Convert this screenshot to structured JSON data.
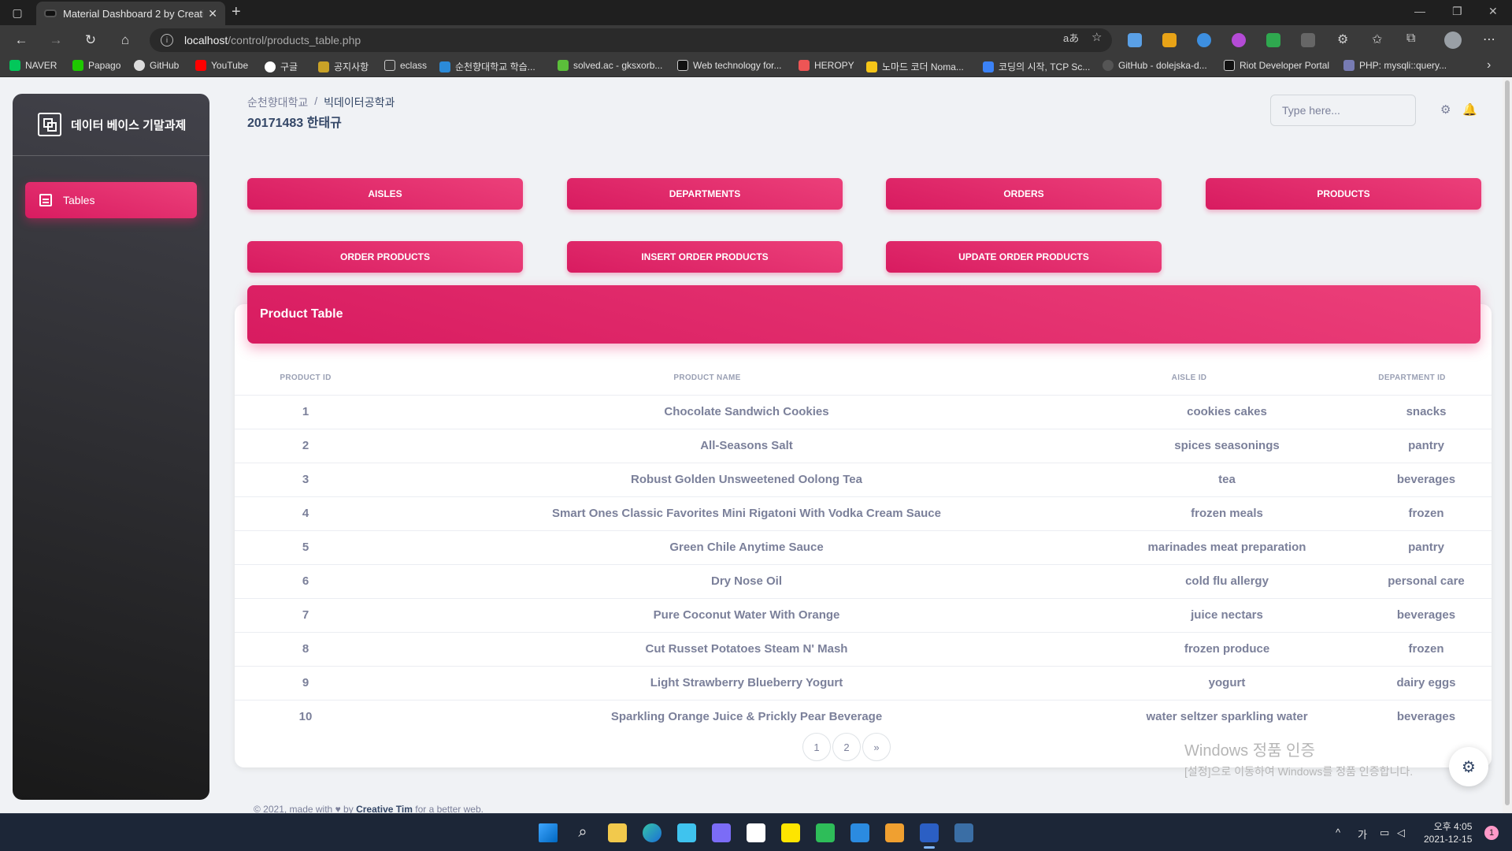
{
  "browser": {
    "tab_title": "Material Dashboard 2 by Creativ...",
    "url_host": "localhost",
    "url_path": "/control/products_table.php",
    "bookmarks": [
      "NAVER",
      "Papago",
      "GitHub",
      "YouTube",
      "구글",
      "공지사항",
      "eclass",
      "순천향대학교 학습...",
      "solved.ac - gksxorb...",
      "Web technology for...",
      "HEROPY",
      "노마드 코더 Noma...",
      "코딩의 시작, TCP Sc...",
      "GitHub - dolejska-d...",
      "Riot Developer Portal",
      "PHP: mysqli::query..."
    ]
  },
  "sidebar": {
    "brand": "데이터 베이스 기말과제",
    "items": [
      {
        "label": "Tables"
      }
    ]
  },
  "header": {
    "breadcrumb_root": "순천향대학교",
    "breadcrumb_sep": "/",
    "breadcrumb_current": "빅데이터공학과",
    "title": "20171483 한태규",
    "search_placeholder": "Type here..."
  },
  "nav_buttons": [
    "AISLES",
    "DEPARTMENTS",
    "ORDERS",
    "PRODUCTS",
    "ORDER PRODUCTS",
    "INSERT ORDER PRODUCTS",
    "UPDATE ORDER PRODUCTS"
  ],
  "table": {
    "title": "Product Table",
    "columns": [
      "PRODUCT ID",
      "PRODUCT NAME",
      "AISLE ID",
      "DEPARTMENT ID"
    ],
    "rows": [
      {
        "id": "1",
        "name": "Chocolate Sandwich Cookies",
        "aisle": "cookies cakes",
        "dept": "snacks"
      },
      {
        "id": "2",
        "name": "All-Seasons Salt",
        "aisle": "spices seasonings",
        "dept": "pantry"
      },
      {
        "id": "3",
        "name": "Robust Golden Unsweetened Oolong Tea",
        "aisle": "tea",
        "dept": "beverages"
      },
      {
        "id": "4",
        "name": "Smart Ones Classic Favorites Mini Rigatoni With Vodka Cream Sauce",
        "aisle": "frozen meals",
        "dept": "frozen"
      },
      {
        "id": "5",
        "name": "Green Chile Anytime Sauce",
        "aisle": "marinades meat preparation",
        "dept": "pantry"
      },
      {
        "id": "6",
        "name": "Dry Nose Oil",
        "aisle": "cold flu allergy",
        "dept": "personal care"
      },
      {
        "id": "7",
        "name": "Pure Coconut Water With Orange",
        "aisle": "juice nectars",
        "dept": "beverages"
      },
      {
        "id": "8",
        "name": "Cut Russet Potatoes Steam N' Mash",
        "aisle": "frozen produce",
        "dept": "frozen"
      },
      {
        "id": "9",
        "name": "Light Strawberry Blueberry Yogurt",
        "aisle": "yogurt",
        "dept": "dairy eggs"
      },
      {
        "id": "10",
        "name": "Sparkling Orange Juice & Prickly Pear Beverage",
        "aisle": "water seltzer sparkling water",
        "dept": "beverages"
      }
    ],
    "pagination": [
      "1",
      "2",
      "»"
    ]
  },
  "watermark": {
    "line1": "Windows 정품 인증",
    "line2": "[설정]으로 이동하여 Windows를 정품 인증합니다."
  },
  "footer": {
    "prefix": "© 2021, made with",
    "by": "by",
    "author": "Creative Tim",
    "suffix": "for a better web."
  },
  "taskbar": {
    "time": "오후 4:05",
    "date": "2021-12-15",
    "ime": "가",
    "notifications": "1"
  },
  "colors": {
    "accent": "#e91e63",
    "sidebar_dark": "#191919"
  }
}
